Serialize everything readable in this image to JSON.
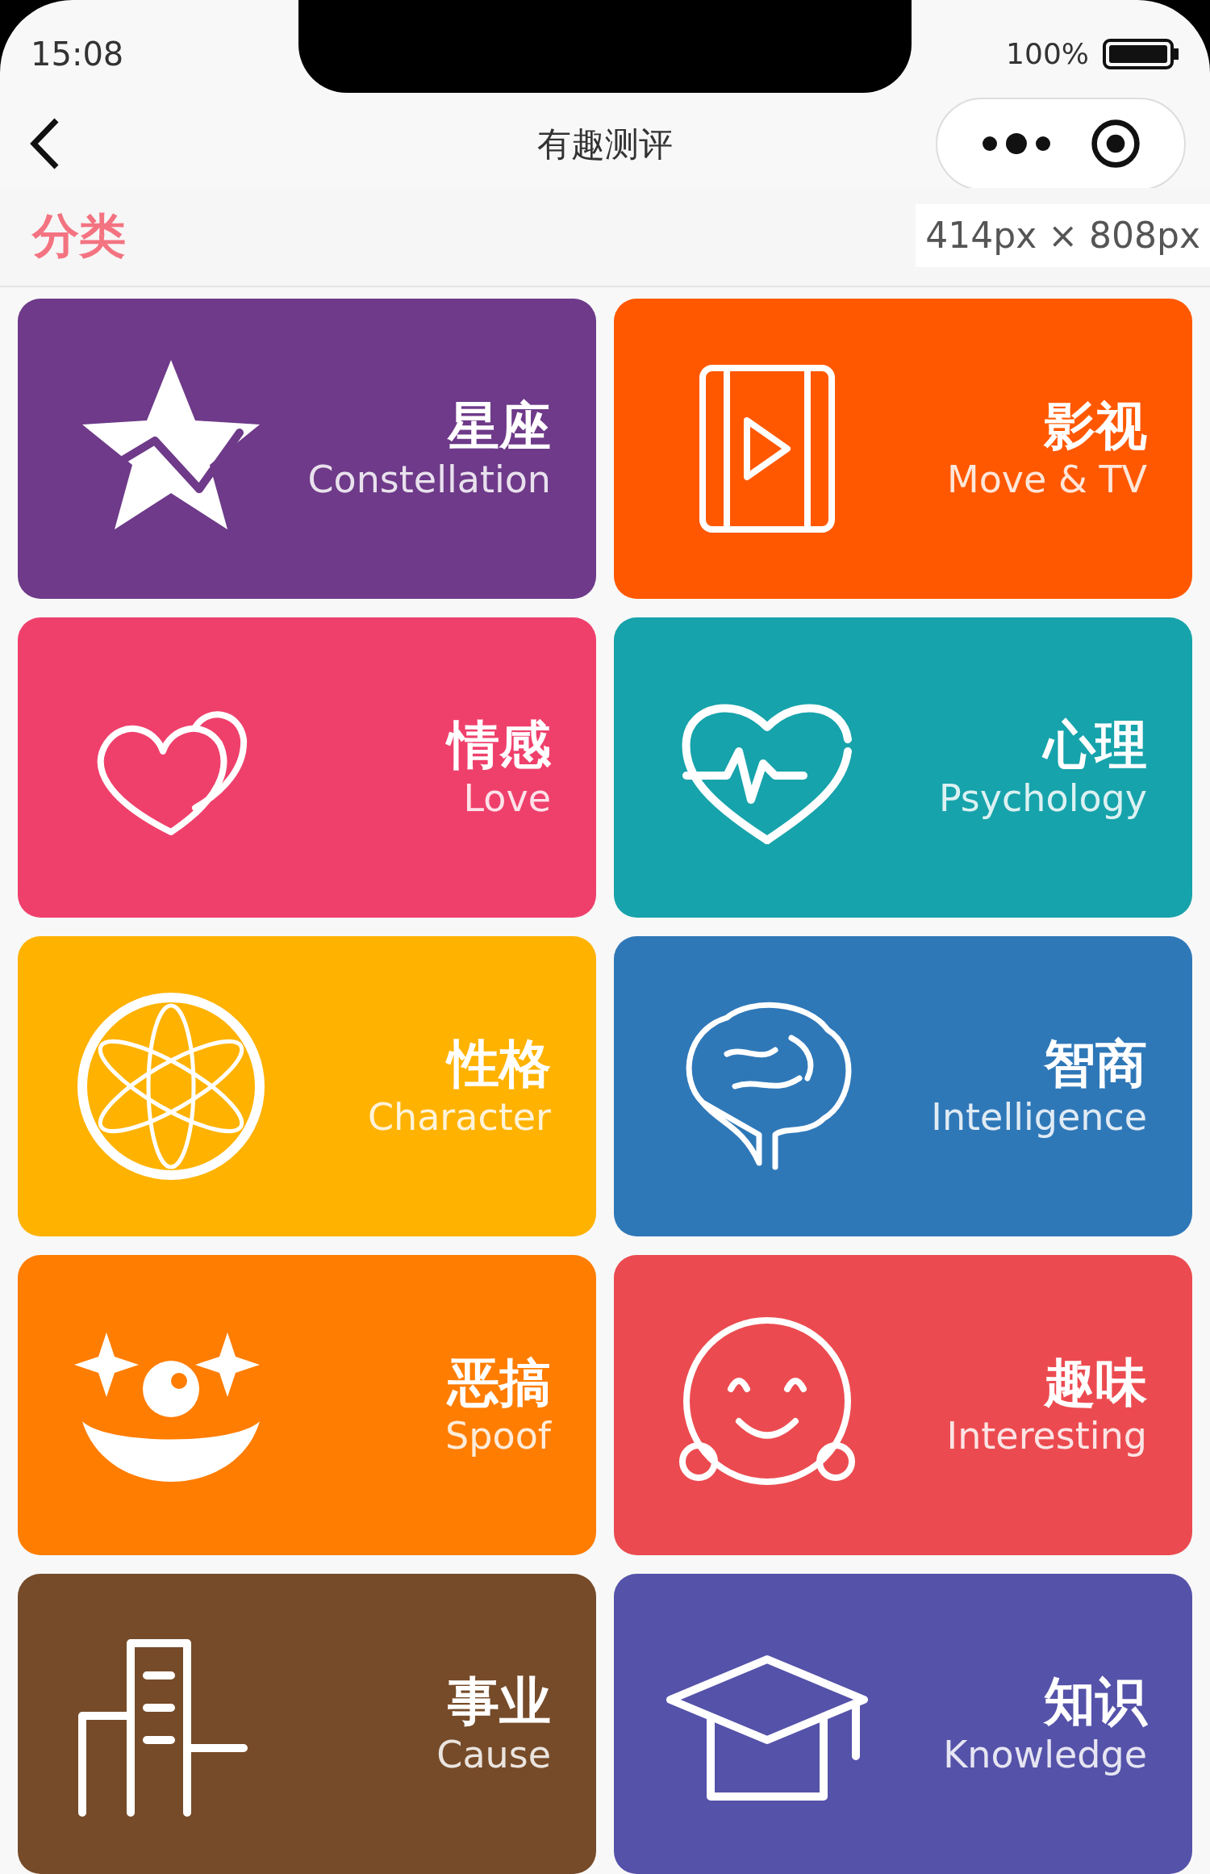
{
  "status_bar": {
    "time": "15:08",
    "battery": "100%"
  },
  "nav_bar": {
    "title": "有趣测评"
  },
  "size_label": "414px × 808px",
  "section": {
    "title": "分类"
  },
  "categories": [
    {
      "title": "星座",
      "subtitle": "Constellation",
      "color": "#6e3a89"
    },
    {
      "title": "影视",
      "subtitle": "Move & TV",
      "color": "#ff5800"
    },
    {
      "title": "情感",
      "subtitle": "Love",
      "color": "#ef406c"
    },
    {
      "title": "心理",
      "subtitle": "Psychology",
      "color": "#17a3ab"
    },
    {
      "title": "性格",
      "subtitle": "Character",
      "color": "#ffb200"
    },
    {
      "title": "智商",
      "subtitle": "Intelligence",
      "color": "#2f78b8"
    },
    {
      "title": "恶搞",
      "subtitle": "Spoof",
      "color": "#ff7d00"
    },
    {
      "title": "趣味",
      "subtitle": "Interesting",
      "color": "#eb4b50"
    },
    {
      "title": "事业",
      "subtitle": "Cause",
      "color": "#764b29"
    },
    {
      "title": "知识",
      "subtitle": "Knowledge",
      "color": "#5552a9"
    }
  ]
}
